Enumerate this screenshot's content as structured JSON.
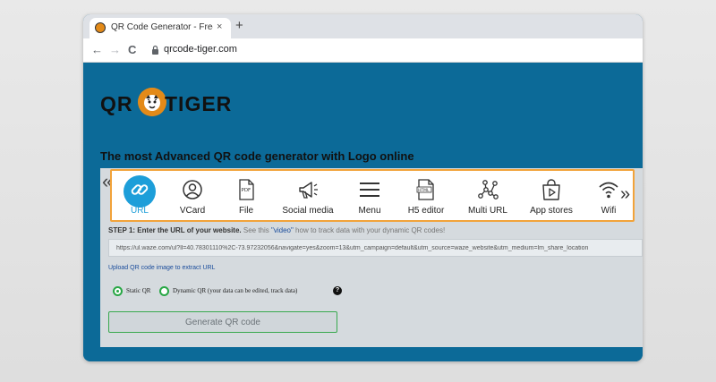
{
  "browser": {
    "tab_title": "QR Code Generator - Free Custom",
    "tab_close": "×",
    "new_tab": "+",
    "back": "←",
    "forward": "→",
    "reload": "C",
    "url": "qrcode-tiger.com"
  },
  "page": {
    "logo_left": "QR",
    "logo_right": "TIGER",
    "headline": "The most Advanced QR code generator with Logo online",
    "nav_prev": "«",
    "nav_next": "»",
    "tools": [
      {
        "label": "URL",
        "icon": "link-icon"
      },
      {
        "label": "VCard",
        "icon": "user-icon"
      },
      {
        "label": "File",
        "icon": "pdf-file-icon"
      },
      {
        "label": "Social media",
        "icon": "megaphone-icon"
      },
      {
        "label": "Menu",
        "icon": "menu-icon"
      },
      {
        "label": "H5 editor",
        "icon": "html-file-icon"
      },
      {
        "label": "Multi URL",
        "icon": "network-icon"
      },
      {
        "label": "App stores",
        "icon": "shopping-bag-icon"
      },
      {
        "label": "Wifi",
        "icon": "wifi-icon"
      }
    ],
    "step": {
      "label": "STEP 1: Enter the URL of your website.",
      "see_this": "See this",
      "video_link": "\"video\"",
      "rest": "how to track data with your dynamic QR codes!"
    },
    "url_value": "https://ul.waze.com/ul?ll=40.78301110%2C-73.97232056&navigate=yes&zoom=13&utm_campaign=default&utm_source=waze_website&utm_medium=lm_share_location",
    "upload_link": "Upload QR code image to extract URL",
    "static_label": "Static QR",
    "dynamic_label": "Dynamic QR (your data can be edited, track data)",
    "help": "?",
    "generate_label": "Generate QR code"
  },
  "colors": {
    "accent": "#1d9ed9",
    "toolbar_border": "#f2a33a",
    "radio": "#28a745",
    "page_bg": "#0c6a98"
  }
}
